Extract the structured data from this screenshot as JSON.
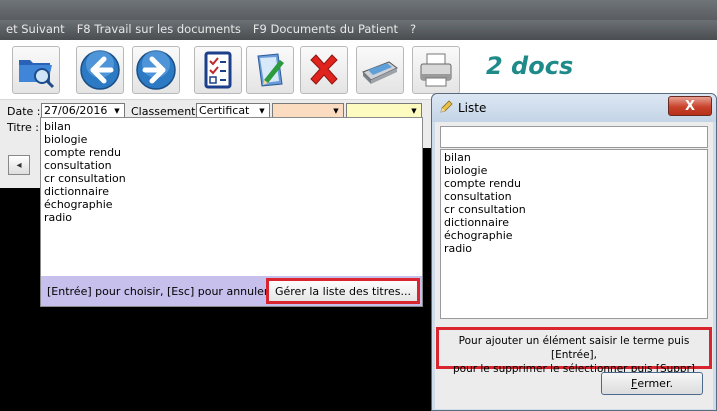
{
  "menubar": {
    "items": [
      "et Suivant",
      "F8 Travail sur les documents",
      "F9 Documents du Patient",
      "?"
    ]
  },
  "toolbar": {
    "icons": [
      "folder-search-icon",
      "back-arrow-icon",
      "forward-arrow-icon",
      "checklist-icon",
      "edit-document-icon",
      "delete-x-icon",
      "scanner-icon",
      "printer-icon"
    ],
    "doc_count": "2 docs"
  },
  "form": {
    "date_label": "Date :",
    "date_value": "27/06/2016",
    "classement_label": "Classement :",
    "classement_value": "Certificat",
    "titre_label": "Titre :"
  },
  "dropdown": {
    "items": [
      "bilan",
      "biologie",
      "compte rendu",
      "consultation",
      "cr consultation",
      "dictionnaire",
      "échographie",
      "radio"
    ],
    "hint": "[Entrée] pour choisir, [Esc] pour annuler...",
    "manage_label": "Gérer la liste des titres..."
  },
  "liste_window": {
    "title": "Liste",
    "close_glyph": "X",
    "items": [
      "bilan",
      "biologie",
      "compte rendu",
      "consultation",
      "cr consultation",
      "dictionnaire",
      "échographie",
      "radio"
    ],
    "help_line1": "Pour ajouter un élément saisir le terme puis [Entrée],",
    "help_line2": "pour le supprimer le sélectionner puis [Suppr]",
    "fermer_first": "F",
    "fermer_rest": "ermer."
  },
  "colors": {
    "accent_teal": "#1e8a8a",
    "highlight_red": "#d9262e",
    "dropdown_footer": "#c8c0ec",
    "field_peach": "#fcdcc0",
    "field_yellow": "#fdfbc0"
  }
}
